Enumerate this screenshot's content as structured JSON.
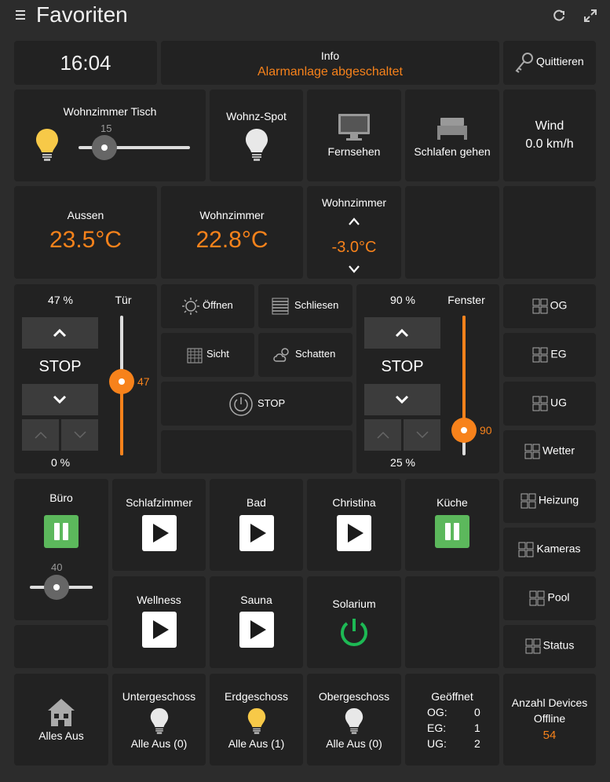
{
  "header": {
    "title": "Favoriten"
  },
  "clock": {
    "time": "16:04"
  },
  "info": {
    "title": "Info",
    "status": "Alarmanlage abgeschaltet"
  },
  "ack": {
    "label": "Quittieren"
  },
  "dimmer1": {
    "label": "Wohnzimmer Tisch",
    "value": "15",
    "level": 0.15
  },
  "spot": {
    "label": "Wohnz-Spot"
  },
  "tv": {
    "label": "Fernsehen"
  },
  "sleep": {
    "label": "Schlafen gehen"
  },
  "wind": {
    "title": "Wind",
    "value": "0.0 km/h"
  },
  "temp_out": {
    "label": "Aussen",
    "value": "23.5°C"
  },
  "temp_living": {
    "label": "Wohnzimmer",
    "value": "22.8°C"
  },
  "setpoint": {
    "label": "Wohnzimmer",
    "value": "-3.0°C"
  },
  "blind1": {
    "pct_top": "47 %",
    "pct_bottom": "0 %",
    "stop": "STOP",
    "name": "Tür",
    "value": "47",
    "level": 0.47
  },
  "blind2": {
    "pct_top": "90 %",
    "pct_bottom": "25 %",
    "stop": "STOP",
    "name": "Fenster",
    "value": "90",
    "level": 0.9
  },
  "scenes": {
    "open": "Öffnen",
    "close": "Schliesen",
    "view": "Sicht",
    "shade": "Schatten",
    "stop": "STOP"
  },
  "nav": {
    "og": "OG",
    "eg": "EG",
    "ug": "UG",
    "weather": "Wetter",
    "heating": "Heizung",
    "cameras": "Kameras",
    "pool": "Pool",
    "status": "Status"
  },
  "audio": {
    "buero": "Büro",
    "buero_volume": "40",
    "buero_level": 0.4,
    "schlafzimmer": "Schlafzimmer",
    "bad": "Bad",
    "christina": "Christina",
    "kueche": "Küche",
    "wellness": "Wellness",
    "sauna": "Sauna",
    "solarium": "Solarium"
  },
  "bottom": {
    "alles_aus": "Alles Aus",
    "ug_title": "Untergeschoss",
    "ug_status": "Alle Aus (0)",
    "eg_title": "Erdgeschoss",
    "eg_status": "Alle Aus (1)",
    "og_title": "Obergeschoss",
    "og_status": "Alle Aus (0)",
    "open_title": "Geöffnet",
    "open_og_k": "OG:",
    "open_og_v": "0",
    "open_eg_k": "EG:",
    "open_eg_v": "1",
    "open_ug_k": "UG:",
    "open_ug_v": "2",
    "offline_title1": "Anzahl Devices",
    "offline_title2": "Offline",
    "offline_value": "54"
  },
  "colors": {
    "accent": "#f7821b",
    "tile": "#222222",
    "bg": "#2c2c2c",
    "green": "#5cb85c",
    "power": "#1db954"
  }
}
